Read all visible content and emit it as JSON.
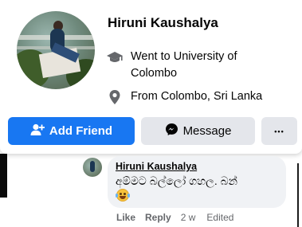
{
  "profile_card": {
    "name": "Hiruni Kaushalya",
    "education_prefix": "Went to ",
    "education_place": "University of Colombo",
    "location_prefix": "From ",
    "location_place": "Colombo, Sri Lanka",
    "add_friend_label": "Add Friend",
    "message_label": "Message",
    "more_label": "•••"
  },
  "comment": {
    "author": "Hiruni Kaushalya",
    "text": "අම්මට බල්ලෝ ගහල. බන්",
    "like_label": "Like",
    "reply_label": "Reply",
    "timestamp": "2 w",
    "edited_label": "Edited"
  },
  "colors": {
    "primary_button": "#1877f2",
    "secondary_button": "#e4e6eb",
    "bubble": "#f0f2f5",
    "meta_text": "#65676b"
  },
  "icons": {
    "education": "graduation-cap-icon",
    "location": "map-pin-icon",
    "add_friend": "add-person-icon",
    "message": "messenger-icon",
    "more": "more-dots-icon",
    "emoji": "laughing-tears-emoji"
  }
}
